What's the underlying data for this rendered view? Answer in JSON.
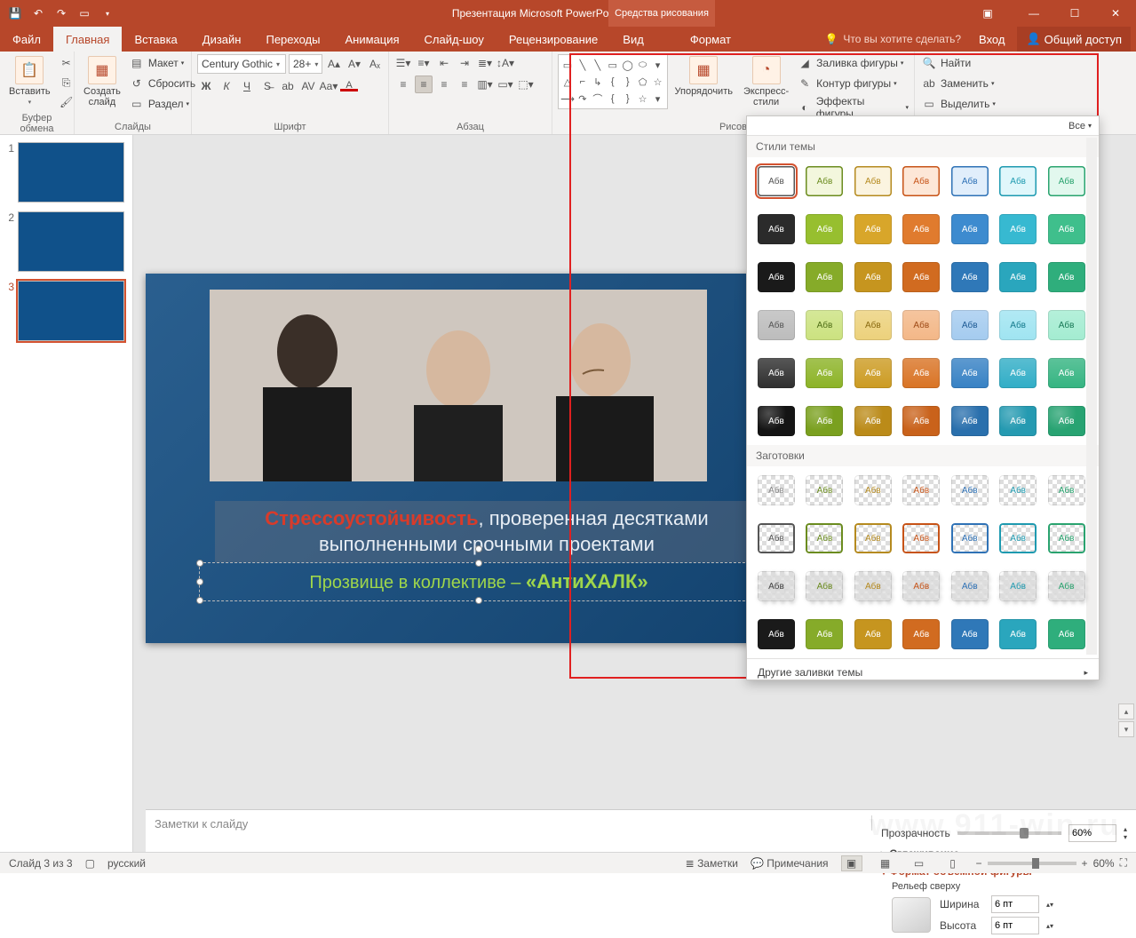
{
  "titlebar": {
    "title": "Презентация Microsoft PowerPoint - PowerPoint",
    "tools_context": "Средства рисования"
  },
  "tabs": {
    "file": "Файл",
    "home": "Главная",
    "insert": "Вставка",
    "design": "Дизайн",
    "transitions": "Переходы",
    "animations": "Анимация",
    "slideshow": "Слайд-шоу",
    "review": "Рецензирование",
    "view": "Вид",
    "format": "Формат",
    "tellme": "Что вы хотите сделать?",
    "signin": "Вход",
    "share": "Общий доступ"
  },
  "ribbon": {
    "clipboard": {
      "label": "Буфер обмена",
      "paste": "Вставить"
    },
    "slides": {
      "label": "Слайды",
      "newslide": "Создать\nслайд",
      "layout": "Макет",
      "reset": "Сбросить",
      "section": "Раздел"
    },
    "font": {
      "label": "Шрифт",
      "family": "Century Gothic",
      "size": "28+"
    },
    "paragraph": {
      "label": "Абзац"
    },
    "drawing": {
      "label": "Рисов",
      "arrange": "Упорядочить",
      "quick": "Экспресс-\nстили",
      "fill": "Заливка фигуры",
      "outline": "Контур фигуры",
      "effects": "Эффекты фигуры"
    },
    "editing": {
      "label": "",
      "find": "Найти",
      "replace": "Заменить",
      "select": "Выделить"
    }
  },
  "gallery": {
    "all": "Все",
    "theme_styles": "Стили темы",
    "presets": "Заготовки",
    "swatch_text": "Абв",
    "more_fills": "Другие заливки темы",
    "theme_rows": [
      {
        "bg": [
          "#ffffff",
          "#f3f7dd",
          "#fbf4e0",
          "#fde7d7",
          "#e1eefb",
          "#e0f7fb",
          "#e2f8ee"
        ],
        "fg": [
          "#555",
          "#6b8c1f",
          "#b58a1f",
          "#c75317",
          "#2f72b6",
          "#1e9ab0",
          "#2aa36f"
        ],
        "border": true
      },
      {
        "bg": [
          "#2b2b2b",
          "#97bf2f",
          "#d8a62a",
          "#e07b2e",
          "#3d8bcf",
          "#37b9d1",
          "#3fbf8c"
        ],
        "fg": [
          "#fff",
          "#fff",
          "#fff",
          "#fff",
          "#fff",
          "#fff",
          "#fff"
        ]
      },
      {
        "bg": [
          "#1a1a1a",
          "#86ab29",
          "#c6951f",
          "#d16b20",
          "#2f78b8",
          "#2aa6bd",
          "#2fae7c"
        ],
        "fg": [
          "#fff",
          "#fff",
          "#fff",
          "#fff",
          "#fff",
          "#fff",
          "#fff"
        ],
        "shadow": true
      },
      {
        "bg": [
          "#bcbcbc",
          "#cbe27f",
          "#ecd17b",
          "#f3b787",
          "#a4cbef",
          "#9fe4f1",
          "#a3ecd1"
        ],
        "fg": [
          "#555",
          "#4e6d15",
          "#8a6a10",
          "#9e4a16",
          "#1d5a94",
          "#147a8c",
          "#197a57"
        ],
        "grad": true
      },
      {
        "bg": [
          "#2e2e2e",
          "#8cb326",
          "#cc9b22",
          "#d97324",
          "#3681c4",
          "#30adc6",
          "#34b481"
        ],
        "fg": [
          "#fff",
          "#fff",
          "#fff",
          "#fff",
          "#fff",
          "#fff",
          "#fff"
        ],
        "grad": true
      },
      {
        "bg": [
          "#141414",
          "#7aa01f",
          "#bb8b19",
          "#c9621b",
          "#2a70ad",
          "#259ab1",
          "#28a372"
        ],
        "fg": [
          "#fff",
          "#fff",
          "#fff",
          "#fff",
          "#fff",
          "#fff",
          "#fff"
        ],
        "bevel": true
      }
    ],
    "preset_rows": [
      {
        "checker": true,
        "fg": [
          "#888",
          "#6b8c1f",
          "#b58a1f",
          "#c75317",
          "#2f72b6",
          "#1e9ab0",
          "#2aa36f"
        ]
      },
      {
        "checker": true,
        "fg": [
          "#555",
          "#6b8c1f",
          "#b58a1f",
          "#c75317",
          "#2f72b6",
          "#1e9ab0",
          "#2aa36f"
        ],
        "outline": true
      },
      {
        "checker": true,
        "fg": [
          "#444",
          "#6b8c1f",
          "#b58a1f",
          "#c75317",
          "#2f72b6",
          "#1e9ab0",
          "#2aa36f"
        ],
        "shadow": true
      },
      {
        "bg": [
          "#1a1a1a",
          "#86ab29",
          "#c6951f",
          "#d16b20",
          "#2f78b8",
          "#2aa6bd",
          "#2fae7c"
        ],
        "fg": [
          "#fff",
          "#fff",
          "#fff",
          "#fff",
          "#fff",
          "#fff",
          "#fff"
        ]
      }
    ]
  },
  "slide": {
    "line1a": "Стрессоустойчивость",
    "line1b": ", проверенная десятками выполненными срочными проектами",
    "line2a": "Прозвище в коллективе – ",
    "line2b": "«АнтиХАЛК»"
  },
  "fmtpane": {
    "transparency": "Прозрачность",
    "transparency_val": "60%",
    "smoothing": "Сглаживание",
    "format3d": "Формат объемной фигуры",
    "topbevel": "Рельеф сверху",
    "width": "Ширина",
    "height": "Высота",
    "w_val": "6 пт",
    "h_val": "6 пт"
  },
  "status": {
    "slide_of": "Слайд 3 из 3",
    "lang": "русский",
    "notes": "Заметки",
    "comments": "Примечания",
    "zoom": "60%"
  },
  "notes_placeholder": "Заметки к слайду",
  "thumbnails": [
    1,
    2,
    3
  ]
}
